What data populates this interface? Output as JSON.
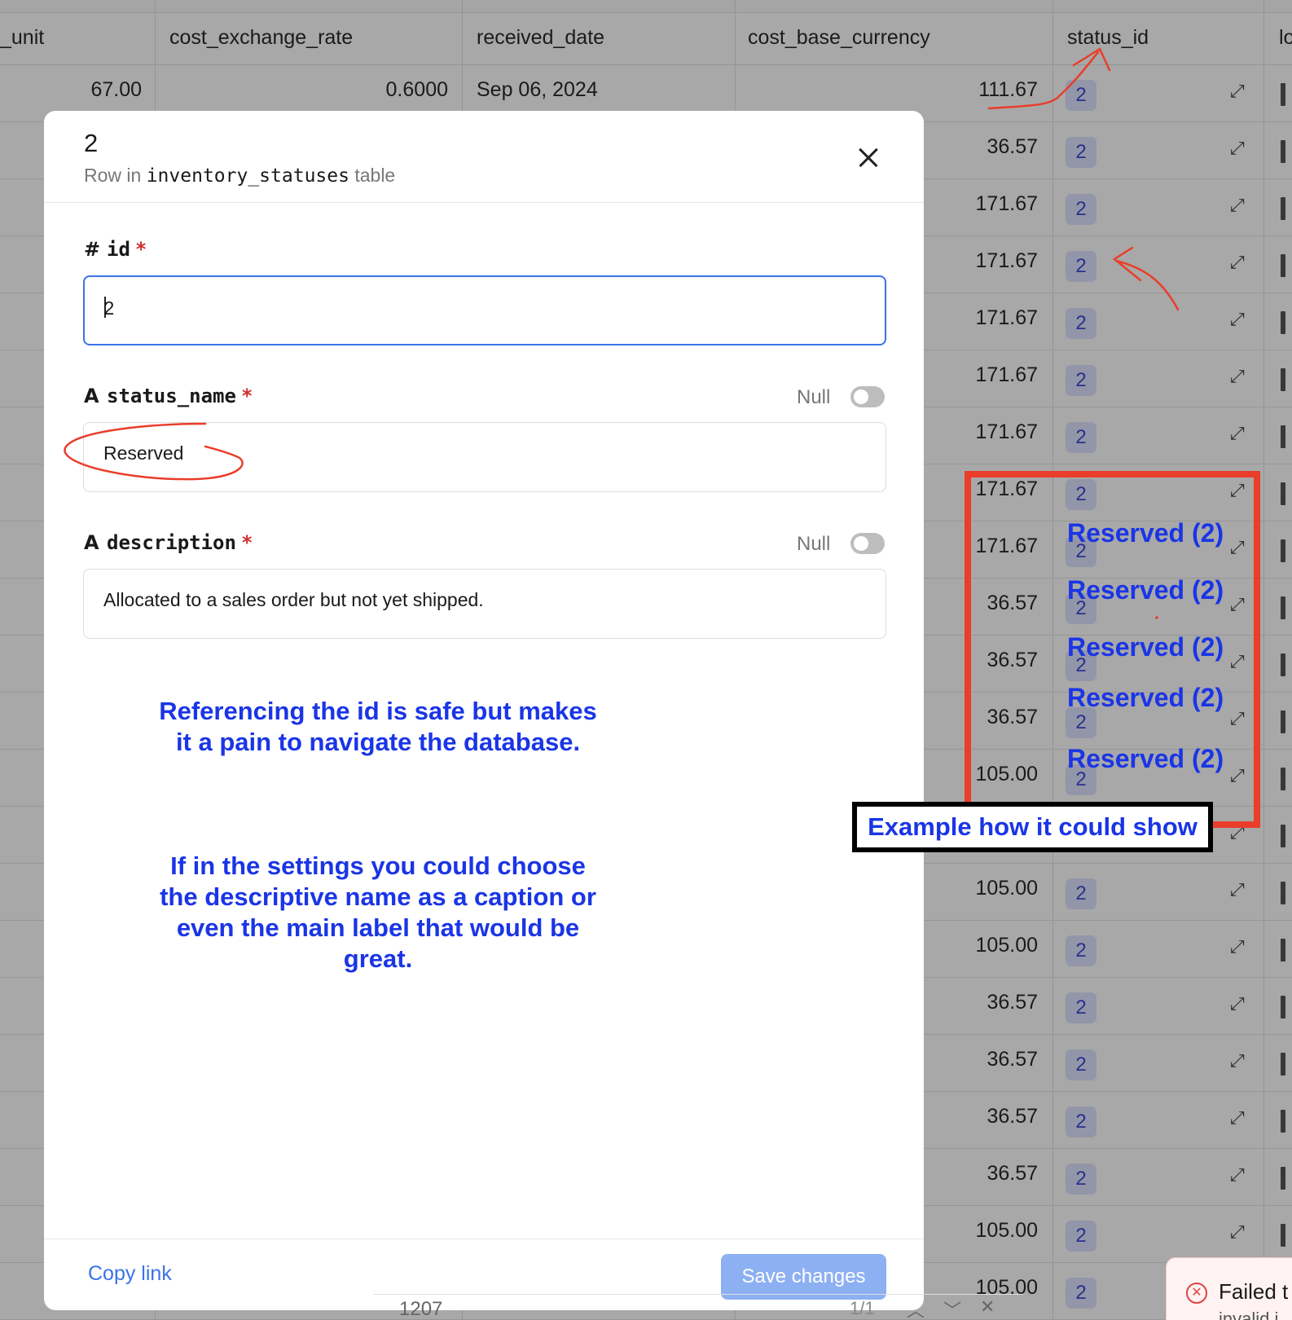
{
  "table": {
    "columns": [
      "_unit",
      "cost_exchange_rate",
      "received_date",
      "cost_base_currency",
      "status_id",
      "lo"
    ],
    "first_row": {
      "unit": "67.00",
      "exchange_rate": "0.6000",
      "received_date": "Sep 06, 2024",
      "cost": "111.67",
      "status": "2"
    },
    "rows": [
      {
        "cost": "36.57",
        "status": "2"
      },
      {
        "cost": "171.67",
        "status": "2"
      },
      {
        "cost": "171.67",
        "status": "2"
      },
      {
        "cost": "171.67",
        "status": "2"
      },
      {
        "cost": "171.67",
        "status": "2"
      },
      {
        "cost": "171.67",
        "status": "2"
      },
      {
        "cost": "171.67",
        "status": "2"
      },
      {
        "cost": "171.67",
        "status": "2"
      },
      {
        "cost": "36.57",
        "status": "2"
      },
      {
        "cost": "36.57",
        "status": "2"
      },
      {
        "cost": "36.57",
        "status": "2"
      },
      {
        "cost": "105.00",
        "status": "2"
      },
      {
        "cost": "",
        "status": ""
      },
      {
        "cost": "105.00",
        "status": "2"
      },
      {
        "cost": "105.00",
        "status": "2"
      },
      {
        "cost": "36.57",
        "status": "2"
      },
      {
        "cost": "36.57",
        "status": "2"
      },
      {
        "cost": "36.57",
        "status": "2"
      },
      {
        "cost": "36.57",
        "status": "2"
      },
      {
        "cost": "105.00",
        "status": "2"
      },
      {
        "cost": "105.00",
        "status": "2"
      }
    ],
    "expand_icon": "expand-arrows-icon"
  },
  "modal": {
    "title": "2",
    "subtitle_prefix": "Row in",
    "subtitle_table": "inventory_statuses",
    "subtitle_suffix": "table",
    "fields": {
      "id": {
        "icon": "#",
        "label": "id",
        "required": "*",
        "value": "2"
      },
      "status_name": {
        "icon": "A",
        "label": "status_name",
        "required": "*",
        "null_label": "Null",
        "value": "Reserved"
      },
      "description": {
        "icon": "A",
        "label": "description",
        "required": "*",
        "null_label": "Null",
        "value": "Allocated to a sales order but not yet shipped."
      }
    },
    "note_1": "Referencing the id is safe but makes it a pain to navigate the database.",
    "note_2": "If in the settings you could choose the descriptive name as a caption or even the main label that would be great.",
    "copy_link": "Copy link",
    "save_changes": "Save changes"
  },
  "annotations": {
    "reserved_label": "Reserved (2)",
    "example_label": "Example how it could show",
    "colors": {
      "red": "#ea3d2a",
      "blue": "#1a35e6"
    }
  },
  "toast": {
    "title": "Failed t",
    "sub": "invalid i"
  },
  "pager": {
    "number": "1207",
    "index": "1/1"
  }
}
